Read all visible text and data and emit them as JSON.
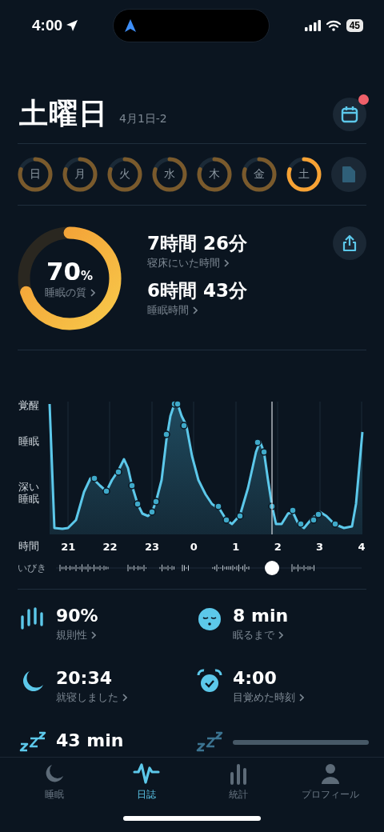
{
  "status_bar": {
    "time": "4:00",
    "battery": "45"
  },
  "header": {
    "title": "土曜日",
    "date_range": "4月1日-2",
    "calendar_badge": true
  },
  "days": [
    {
      "label": "日",
      "selected": false
    },
    {
      "label": "月",
      "selected": false
    },
    {
      "label": "火",
      "selected": false
    },
    {
      "label": "水",
      "selected": false
    },
    {
      "label": "木",
      "selected": false
    },
    {
      "label": "金",
      "selected": false
    },
    {
      "label": "土",
      "selected": true
    }
  ],
  "score": {
    "value": "70",
    "unit": "%",
    "label": "睡眠の質",
    "level": 0.7
  },
  "durations": [
    {
      "value": "7時間 26分",
      "label": "寝床にいた時間"
    },
    {
      "value": "6時間 43分",
      "label": "睡眠時間"
    }
  ],
  "chart": {
    "y_labels": [
      "覚醒",
      "睡眠",
      "深い睡眠"
    ],
    "x_axis_label": "時間",
    "x_labels": [
      "21",
      "22",
      "23",
      "0",
      "1",
      "2",
      "3",
      "4"
    ],
    "snore_label": "いびき"
  },
  "metrics": [
    {
      "kind": "value",
      "value": "90%",
      "label": "規則性"
    },
    {
      "kind": "value",
      "value": "8 min",
      "label": "眠るまで"
    },
    {
      "kind": "value",
      "value": "20:34",
      "label": "就寝しました"
    },
    {
      "kind": "value",
      "value": "4:00",
      "label": "目覚めた時刻"
    },
    {
      "kind": "value",
      "value": "43 min"
    },
    {
      "kind": "placeholder"
    }
  ],
  "tabs": [
    {
      "label": "睡眠",
      "selected": false
    },
    {
      "label": "日誌",
      "selected": true
    },
    {
      "label": "統計",
      "selected": false
    },
    {
      "label": "プロフィール",
      "selected": false
    }
  ]
}
